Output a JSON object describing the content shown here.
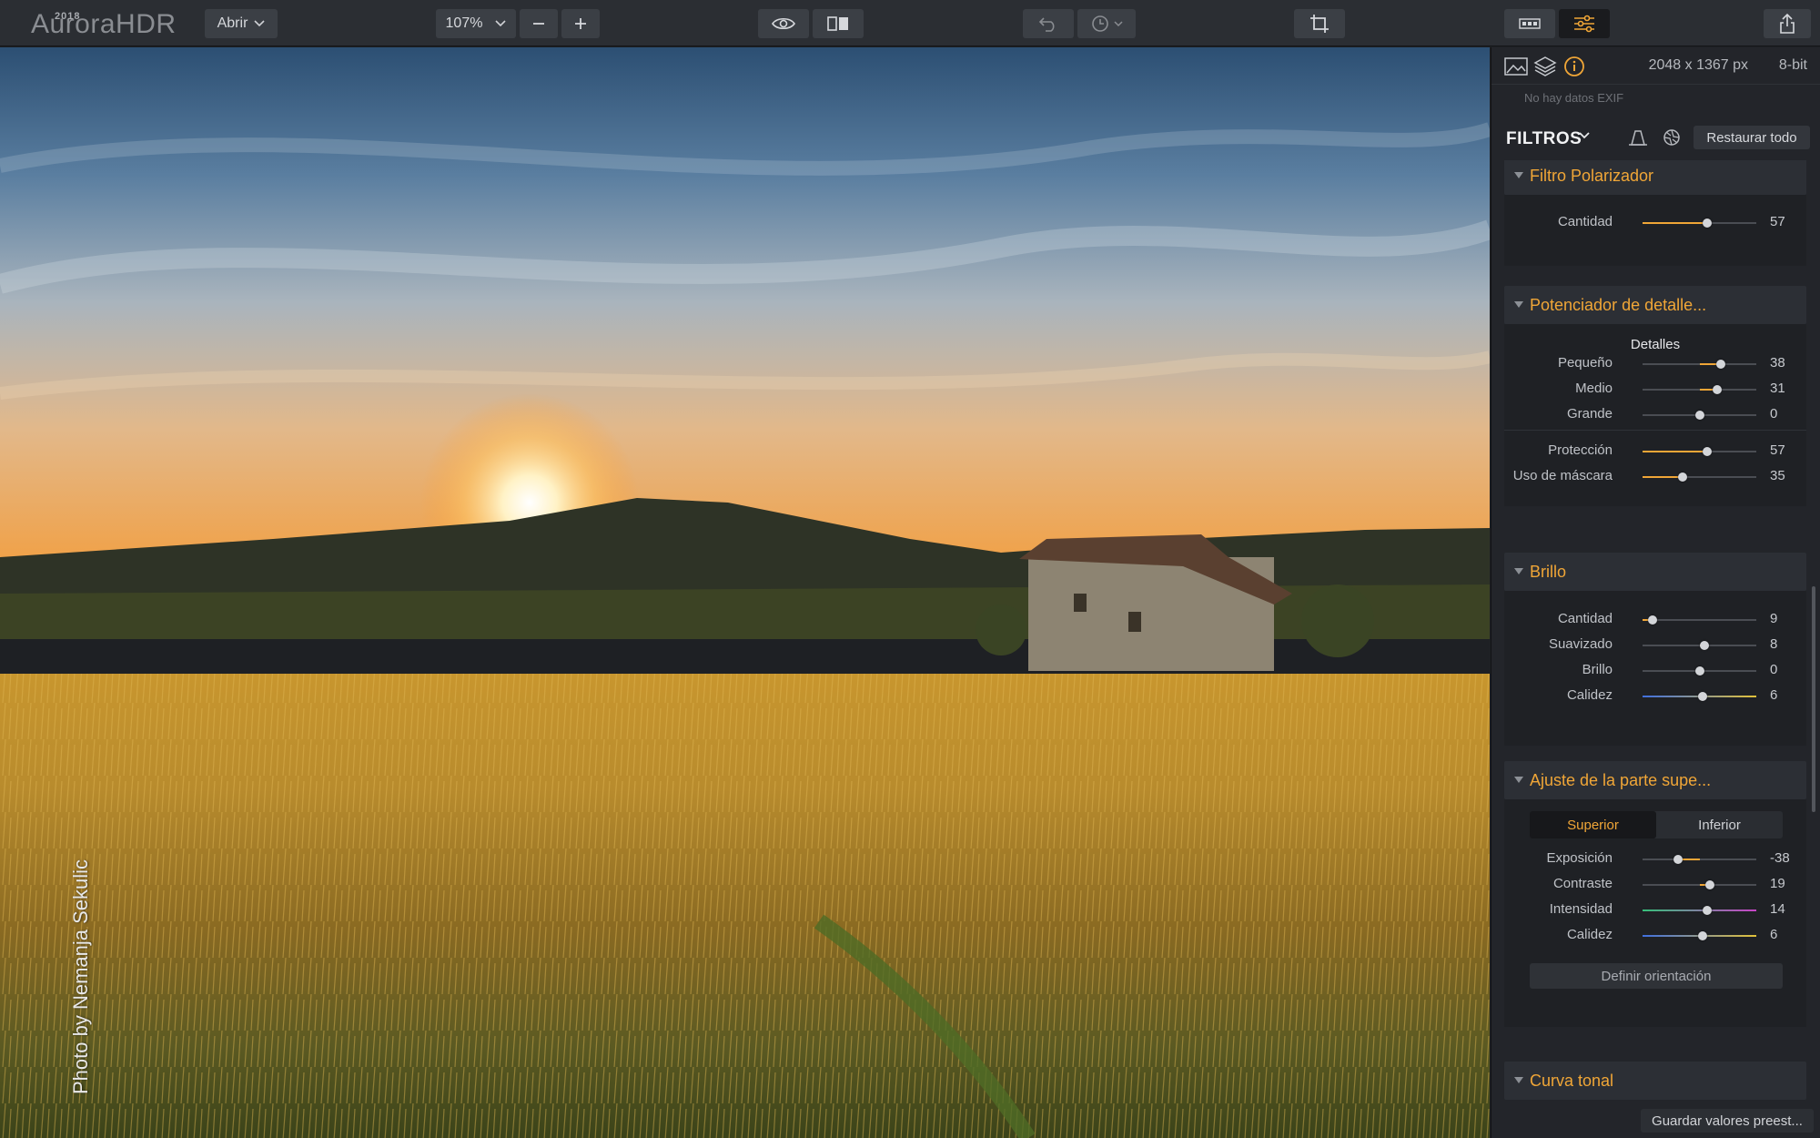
{
  "app": {
    "logo": "AuroraHDR",
    "logo_year": "2018"
  },
  "toolbar": {
    "open_label": "Abrir",
    "zoom_value": "107%",
    "zoom_out_icon": "minus-icon",
    "zoom_in_icon": "plus-icon",
    "preview_icon": "eye-icon",
    "compare_icon": "split-view-icon",
    "undo_icon": "undo-icon",
    "history_icon": "clock-icon",
    "crop_icon": "crop-icon",
    "filmstrip_icon": "filmstrip-icon",
    "adjustments_icon": "sliders-icon",
    "share_icon": "share-icon"
  },
  "photo": {
    "credit": "Photo by Nemanja Sekulic"
  },
  "panel": {
    "image_size": "2048 x 1367 px",
    "bit_depth": "8-bit",
    "exif": "No hay datos EXIF",
    "filters_title": "FILTROS",
    "reset_label": "Restaurar todo",
    "save_preset_label": "Guardar valores preest..."
  },
  "sections": {
    "polarizer": {
      "title": "Filtro Polarizador",
      "sliders": [
        {
          "label": "Cantidad",
          "value": 57
        }
      ]
    },
    "detail": {
      "title": "Potenciador de detalle...",
      "subtitle": "Detalles",
      "sliders": [
        {
          "label": "Pequeño",
          "value": 38
        },
        {
          "label": "Medio",
          "value": 31
        },
        {
          "label": "Grande",
          "value": 0
        },
        {
          "label": "Protección",
          "value": 57
        },
        {
          "label": "Uso de máscara",
          "value": 35
        }
      ]
    },
    "glow": {
      "title": "Brillo",
      "sliders": [
        {
          "label": "Cantidad",
          "value": 9
        },
        {
          "label": "Suavizado",
          "value": 8
        },
        {
          "label": "Brillo",
          "value": 0
        },
        {
          "label": "Calidez",
          "value": 6
        }
      ]
    },
    "topbottom": {
      "title": "Ajuste de la parte supe...",
      "tab_top": "Superior",
      "tab_bottom": "Inferior",
      "sliders": [
        {
          "label": "Exposición",
          "value": -38
        },
        {
          "label": "Contraste",
          "value": 19
        },
        {
          "label": "Intensidad",
          "value": 14
        },
        {
          "label": "Calidez",
          "value": 6
        }
      ],
      "orientation_label": "Definir orientación"
    },
    "tonecurve": {
      "title": "Curva tonal"
    }
  },
  "colors": {
    "accent": "#f0a637",
    "panel_bg": "#23252a",
    "toolbar_bg": "#2b2e33"
  }
}
